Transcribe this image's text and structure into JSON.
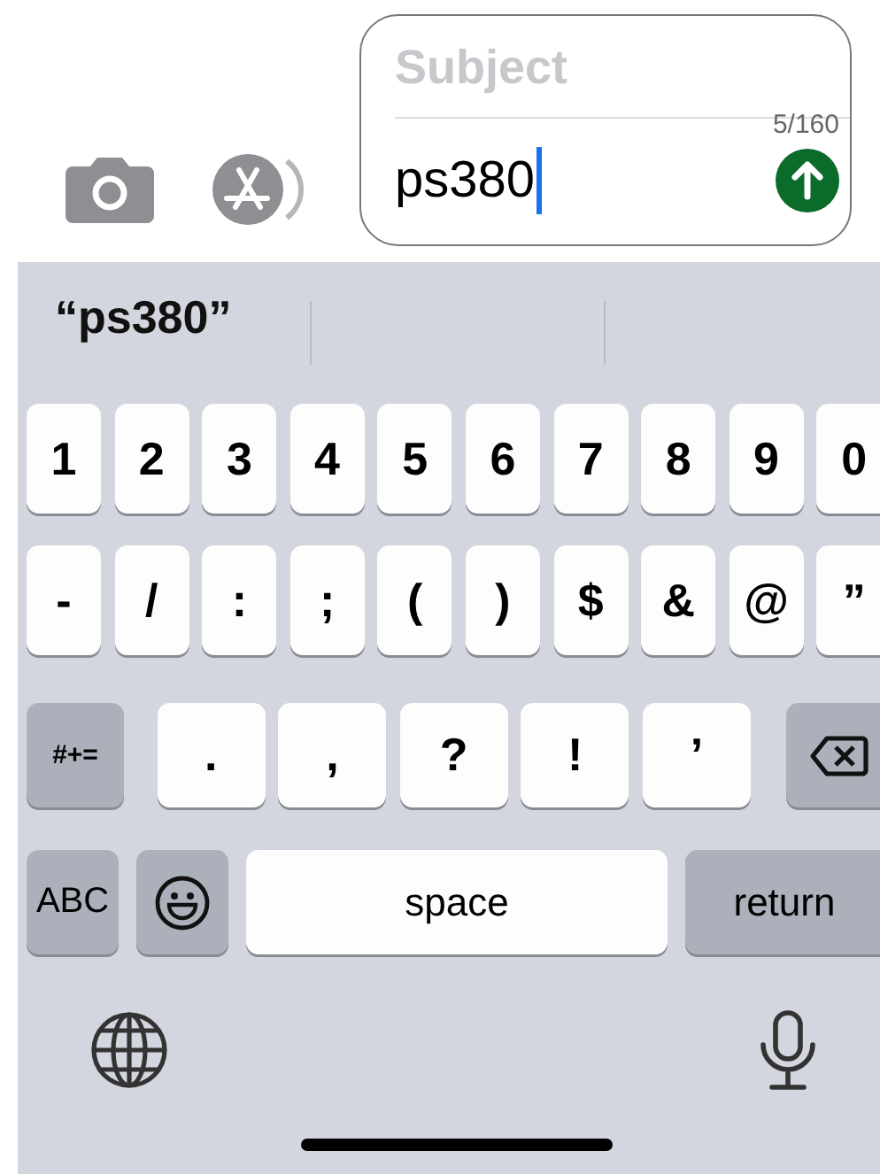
{
  "composer": {
    "subject_placeholder": "Subject",
    "counter": "5/160",
    "value": "ps380"
  },
  "suggestions": [
    "“ps380”"
  ],
  "keyboard": {
    "rows": [
      {
        "keys": [
          {
            "kind": "char",
            "label": "1"
          },
          {
            "kind": "char",
            "label": "2"
          },
          {
            "kind": "char",
            "label": "3"
          },
          {
            "kind": "char",
            "label": "4"
          },
          {
            "kind": "char",
            "label": "5"
          },
          {
            "kind": "char",
            "label": "6"
          },
          {
            "kind": "char",
            "label": "7"
          },
          {
            "kind": "char",
            "label": "8"
          },
          {
            "kind": "char",
            "label": "9"
          },
          {
            "kind": "char",
            "label": "0"
          }
        ]
      },
      {
        "keys": [
          {
            "kind": "char",
            "label": "-"
          },
          {
            "kind": "char",
            "label": "/"
          },
          {
            "kind": "char",
            "label": ":"
          },
          {
            "kind": "char",
            "label": ";"
          },
          {
            "kind": "char",
            "label": "("
          },
          {
            "kind": "char",
            "label": ")"
          },
          {
            "kind": "char",
            "label": "$"
          },
          {
            "kind": "char",
            "label": "&"
          },
          {
            "kind": "char",
            "label": "@"
          },
          {
            "kind": "char",
            "label": "”"
          }
        ]
      },
      {
        "keys": [
          {
            "kind": "function",
            "label": "#+="
          },
          {
            "kind": "char",
            "label": "."
          },
          {
            "kind": "char",
            "label": ","
          },
          {
            "kind": "char",
            "label": "?"
          },
          {
            "kind": "char",
            "label": "!"
          },
          {
            "kind": "char",
            "label": "’"
          },
          {
            "kind": "delete"
          }
        ]
      },
      {
        "keys": [
          {
            "kind": "function",
            "label": "ABC"
          },
          {
            "kind": "emoji"
          },
          {
            "kind": "space",
            "label": "space"
          },
          {
            "kind": "function",
            "label": "return"
          }
        ]
      }
    ]
  }
}
